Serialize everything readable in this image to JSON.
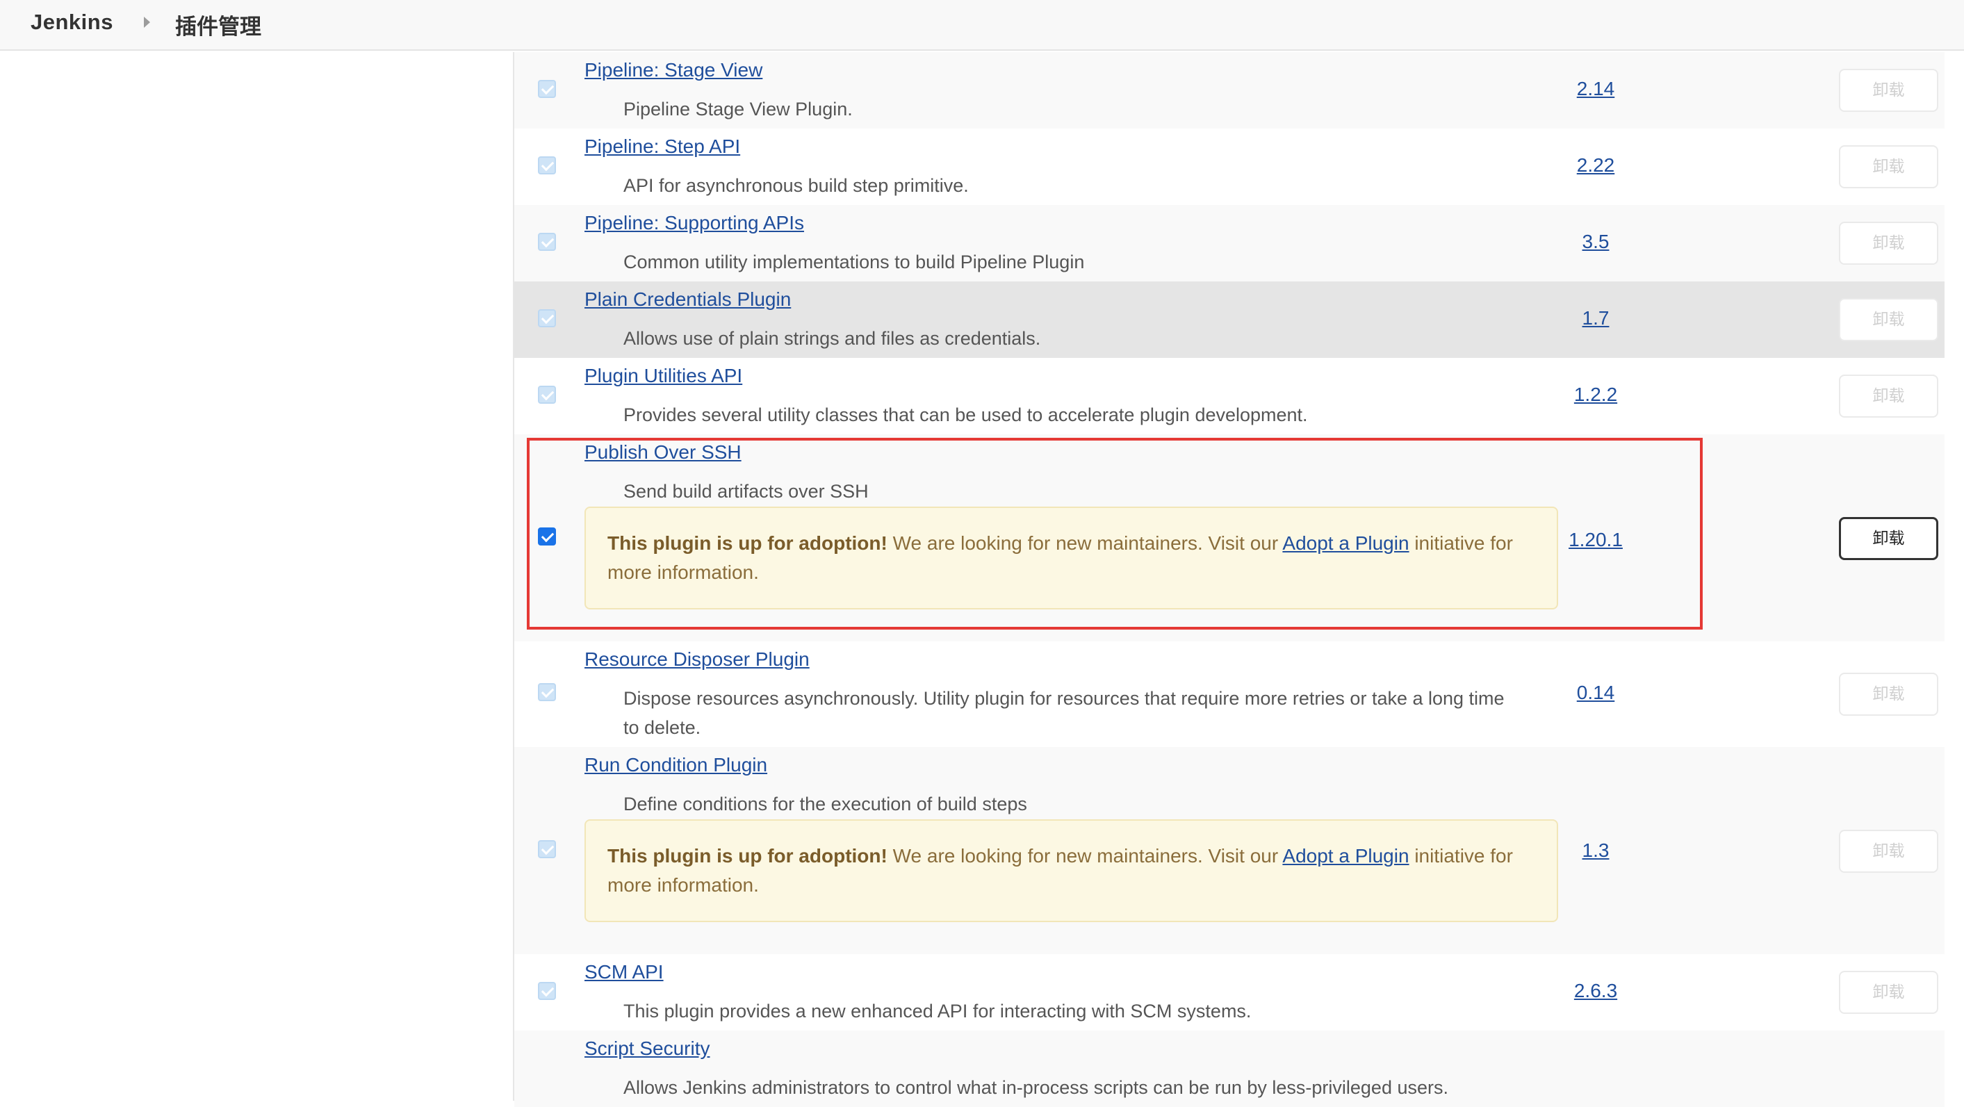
{
  "breadcrumb": {
    "root": "Jenkins",
    "page": "插件管理"
  },
  "adoption_notice": {
    "bold": "This plugin is up for adoption!",
    "text_before_link": " We are looking for new maintainers. Visit our ",
    "link": "Adopt a Plugin",
    "text_after_link": " initiative for more information."
  },
  "uninstall_label": "卸载",
  "plugins": [
    {
      "name": "Pipeline: Stage View",
      "description": "Pipeline Stage View Plugin.",
      "version": "2.14",
      "checked": true,
      "enabled": false
    },
    {
      "name": "Pipeline: Step API",
      "description": "API for asynchronous build step primitive.",
      "version": "2.22",
      "checked": true,
      "enabled": false
    },
    {
      "name": "Pipeline: Supporting APIs",
      "description": "Common utility implementations to build Pipeline Plugin",
      "version": "3.5",
      "checked": true,
      "enabled": false
    },
    {
      "name": "Plain Credentials Plugin",
      "description": "Allows use of plain strings and files as credentials.",
      "version": "1.7",
      "checked": true,
      "enabled": false
    },
    {
      "name": "Plugin Utilities API",
      "description": "Provides several utility classes that can be used to accelerate plugin development.",
      "version": "1.2.2",
      "checked": true,
      "enabled": false
    },
    {
      "name": "Publish Over SSH",
      "description": "Send build artifacts over SSH",
      "version": "1.20.1",
      "checked": true,
      "enabled": true,
      "adoption": true
    },
    {
      "name": "Resource Disposer Plugin",
      "description": "Dispose resources asynchronously. Utility plugin for resources that require more retries or take a long time to delete.",
      "version": "0.14",
      "checked": true,
      "enabled": false
    },
    {
      "name": "Run Condition Plugin",
      "description": "Define conditions for the execution of build steps",
      "version": "1.3",
      "checked": true,
      "enabled": false,
      "adoption": true
    },
    {
      "name": "SCM API",
      "description": "This plugin provides a new enhanced API for interacting with SCM systems.",
      "version": "2.6.3",
      "checked": true,
      "enabled": false
    },
    {
      "name": "Script Security",
      "description": "Allows Jenkins administrators to control what in-process scripts can be run by less-privileged users."
    }
  ]
}
